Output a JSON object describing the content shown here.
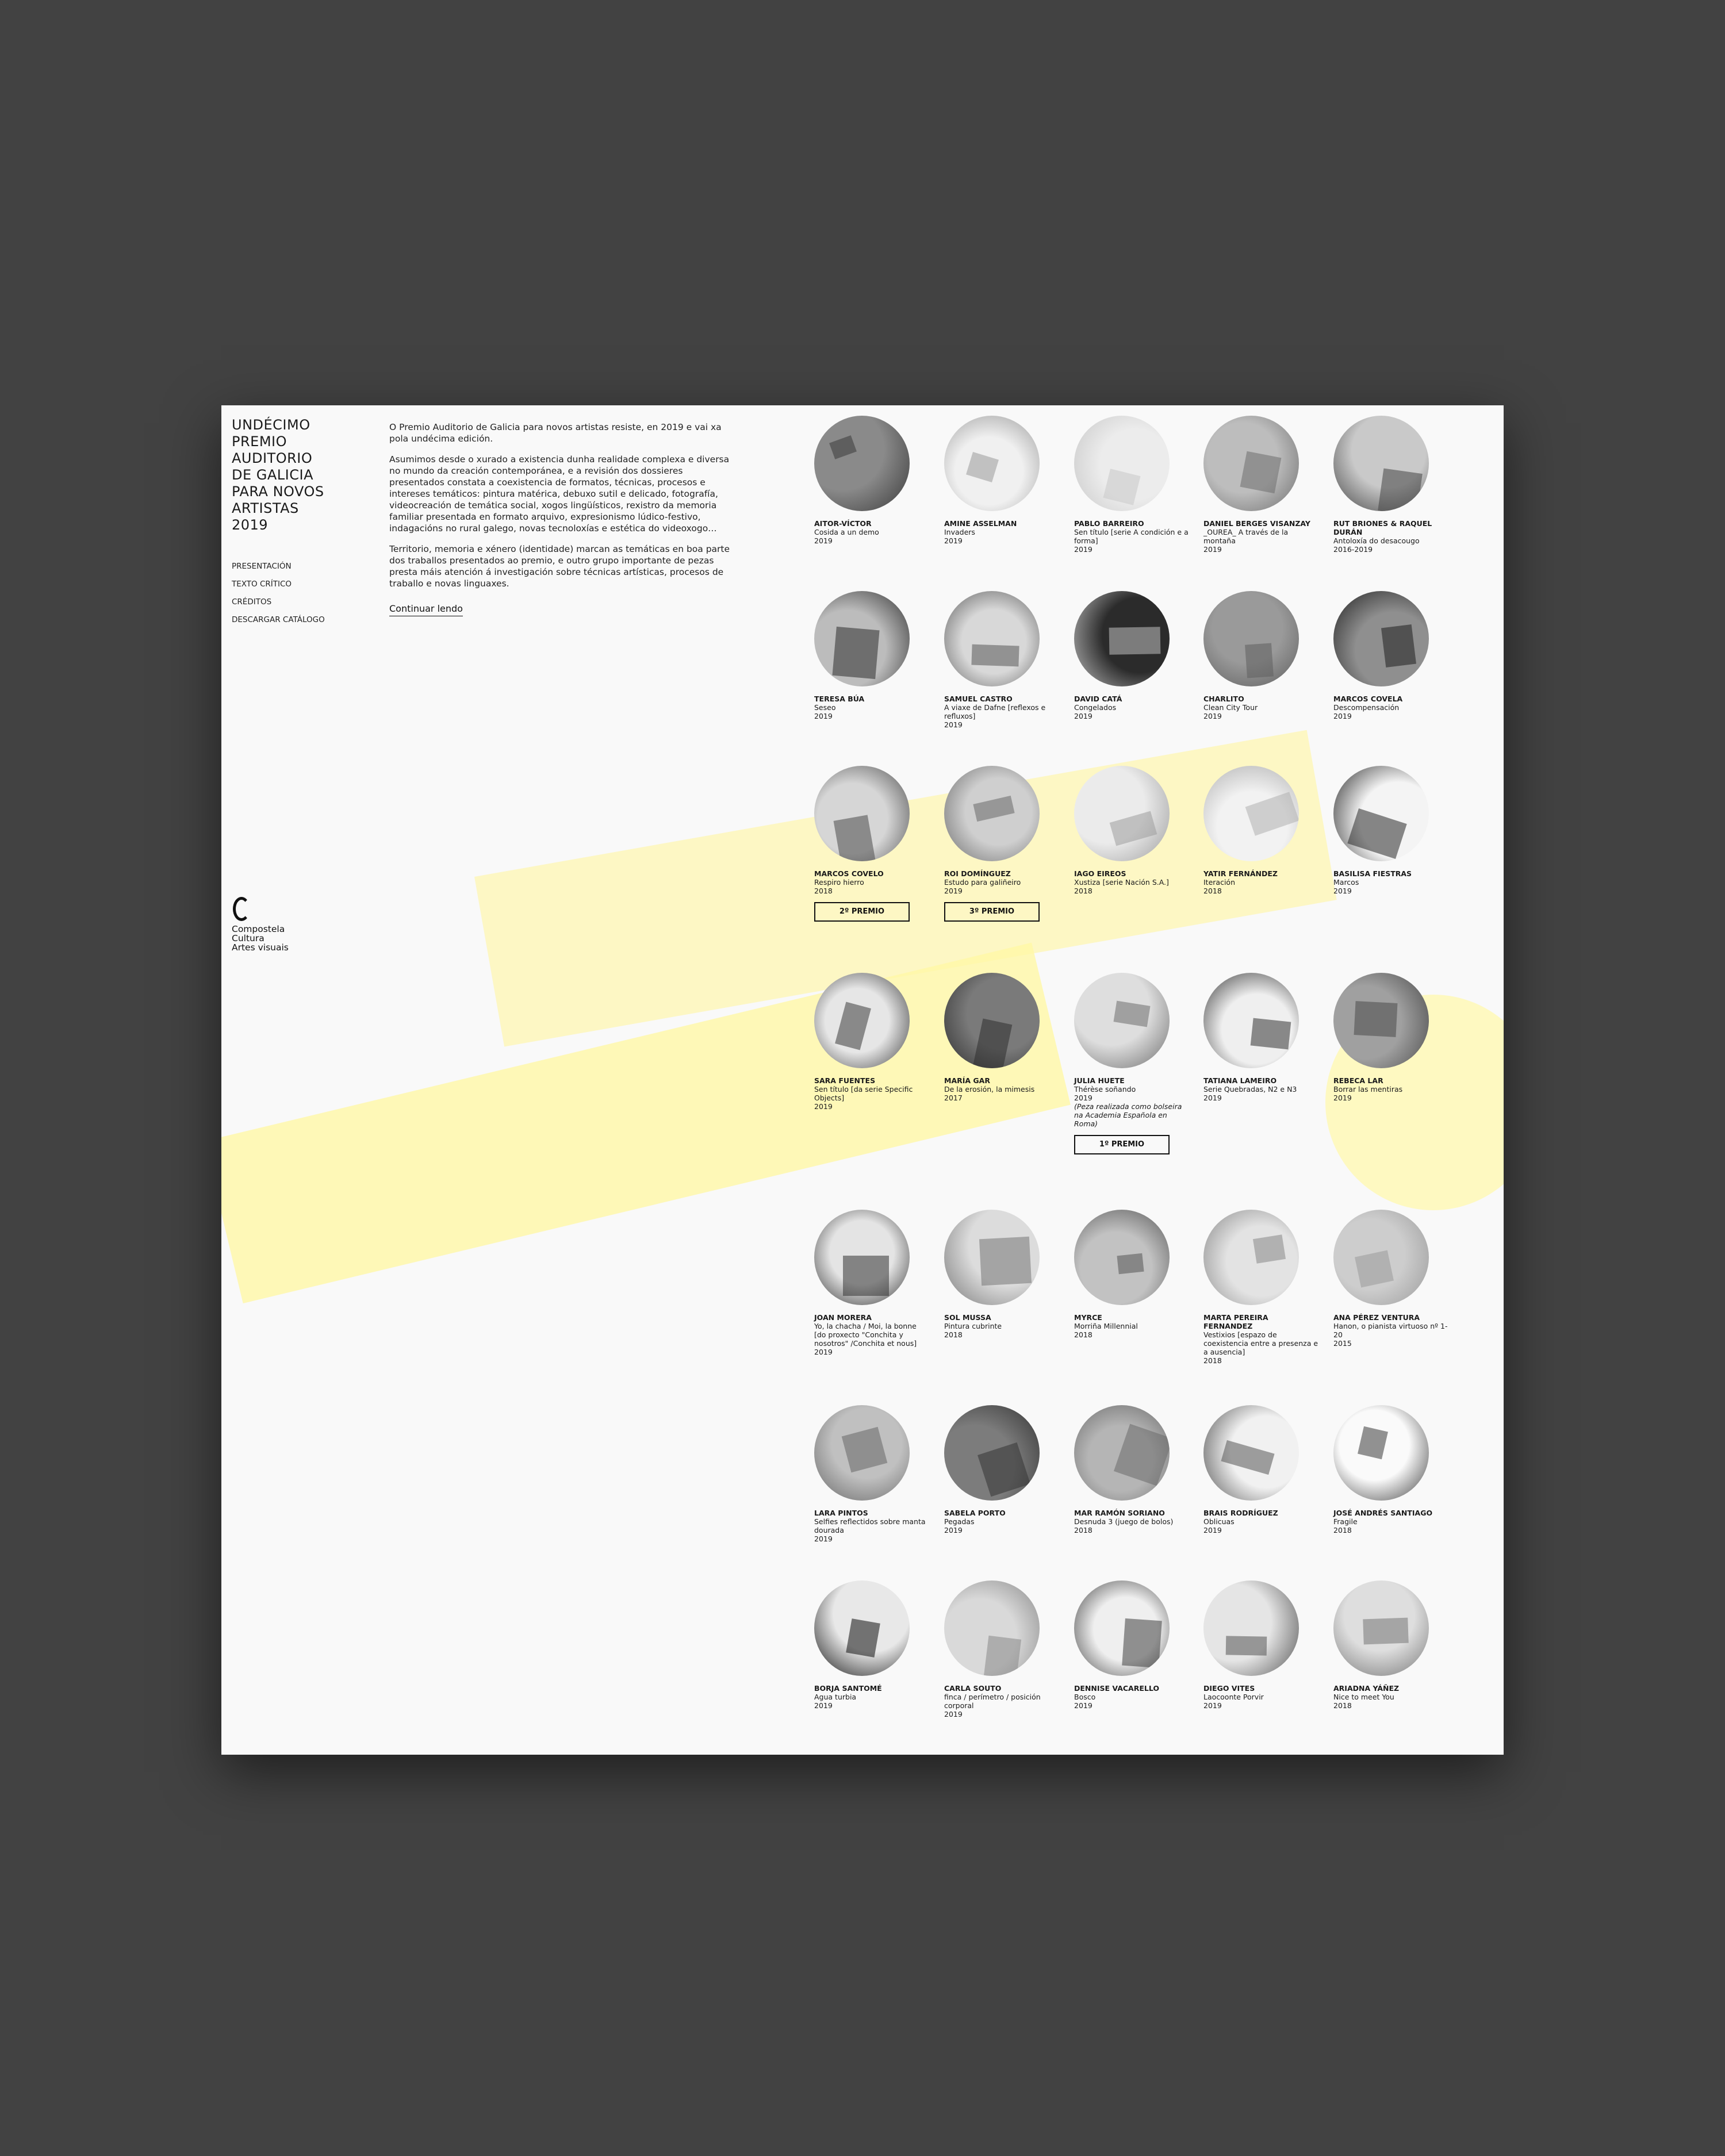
{
  "site": {
    "title": "UNDÉCIMO\nPREMIO\nAUDITORIO\nDE GALICIA\nPARA NOVOS\nARTISTAS\n2019"
  },
  "nav": {
    "items": [
      {
        "label": "PRESENTACIÓN"
      },
      {
        "label": "TEXTO CRÍTICO"
      },
      {
        "label": "CRÉDITOS"
      },
      {
        "label": "DESCARGAR CATÁLOGO"
      }
    ]
  },
  "intro": {
    "paragraphs": [
      "O Premio Auditorio de Galicia para novos artistas resiste, en 2019 e vai xa pola undécima edición.",
      "Asumimos desde o xurado a existencia dunha realidade complexa e diversa no mundo da creación contemporánea, e a revisión dos dossieres presentados constata a coexistencia de formatos, técnicas, procesos e intereses temáticos: pintura matérica, debuxo sutil e delicado, fotografía, videocreación de temática social, xogos lingüísticos, rexistro da memoria familiar presentada en formato arquivo, expresionismo lúdico-festivo, indagacións no rural galego, novas tecnoloxías e estética do videoxogo…",
      "Territorio, memoria e xénero (identidade) marcan as temáticas en boa parte dos traballos presentados ao premio, e outro grupo importante de pezas presta máis atención á investigación sobre técnicas artísticas, procesos de traballo e novas linguaxes."
    ],
    "continue_label": "Continuar lendo"
  },
  "logo": {
    "line1": "Compostela",
    "line2": "Cultura",
    "line3": "Artes visuais"
  },
  "colors": {
    "accent_yellow": "#fff59d",
    "page_bg": "#f9f9f9",
    "backdrop": "#424242"
  },
  "artists": [
    {
      "name": "AITOR-VÍCTOR",
      "work": "Cosida a un demo",
      "year": "2019"
    },
    {
      "name": "AMINE ASSELMAN",
      "work": "Invaders",
      "year": "2019"
    },
    {
      "name": "PABLO BARREIRO",
      "work": "Sen título [serie A condición e a forma]",
      "year": "2019"
    },
    {
      "name": "DANIEL BERGES VISANZAY",
      "work": "_OUREA_ A través de la montaña",
      "year": "2019"
    },
    {
      "name": "RUT BRIONES & RAQUEL DURÁN",
      "work": "Antoloxía do desacougo",
      "year": "2016-2019"
    },
    {
      "name": "TERESA BÚA",
      "work": "Seseo",
      "year": "2019"
    },
    {
      "name": "SAMUEL CASTRO",
      "work": "A viaxe de Dafne [reflexos e refluxos]",
      "year": "2019"
    },
    {
      "name": "DAVID CATÁ",
      "work": "Congelados",
      "year": "2019"
    },
    {
      "name": "CHARLITO",
      "work": "Clean City Tour",
      "year": "2019"
    },
    {
      "name": "MARCOS COVELA",
      "work": "Descompensación",
      "year": "2019"
    },
    {
      "name": "MARCOS COVELO",
      "work": "Respiro hierro",
      "year": "2018",
      "prize": "2º PREMIO"
    },
    {
      "name": "ROI DOMÍNGUEZ",
      "work": "Estudo para galiñeiro",
      "year": "2019",
      "prize": "3º PREMIO"
    },
    {
      "name": "IAGO EIREOS",
      "work": "Xustiza [serie Nación S.A.]",
      "year": "2018"
    },
    {
      "name": "YATIR FERNÁNDEZ",
      "work": "Iteración",
      "year": "2018"
    },
    {
      "name": "BASILISA FIESTRAS",
      "work": "Marcos",
      "year": "2019"
    },
    {
      "name": "SARA FUENTES",
      "work": "Sen título [da serie Specific Objects]",
      "year": "2019"
    },
    {
      "name": "MARÍA GAR",
      "work": "De la erosión, la mimesis",
      "year": "2017"
    },
    {
      "name": "JULIA HUETE",
      "work": "Thérèse soñando",
      "year": "2019",
      "note": "(Peza realizada como bolseira na Academia Española en Roma)",
      "prize": "1º PREMIO"
    },
    {
      "name": "TATIANA LAMEIRO",
      "work": "Serie Quebradas, N2 e N3",
      "year": "2019"
    },
    {
      "name": "REBECA LAR",
      "work": "Borrar las mentiras",
      "year": "2019"
    },
    {
      "name": "JOAN MORERA",
      "work": "Yo, la chacha / Moi, la bonne [do proxecto \"Conchita y nosotros\" /Conchita et nous]",
      "year": "2019"
    },
    {
      "name": "SOL MUSSA",
      "work": "Pintura cubrinte",
      "year": "2018"
    },
    {
      "name": "MYRCE",
      "work": "Morriña Millennial",
      "year": "2018"
    },
    {
      "name": "MARTA PEREIRA FERNANDEZ",
      "work": "Vestixios [espazo de coexistencia entre a presenza e a ausencia]",
      "year": "2018"
    },
    {
      "name": "ANA PÉREZ VENTURA",
      "work": "Hanon, o pianista virtuoso nº 1-20",
      "year": "2015"
    },
    {
      "name": "LARA PINTOS",
      "work": "Selfies reflectidos sobre manta dourada",
      "year": "2019"
    },
    {
      "name": "SABELA PORTO",
      "work": "Pegadas",
      "year": "2019"
    },
    {
      "name": "MAR RAMÓN SORIANO",
      "work": "Desnuda 3 (juego de bolos)",
      "year": "2018"
    },
    {
      "name": "BRAIS RODRÍGUEZ",
      "work": "Oblicuas",
      "year": "2019"
    },
    {
      "name": "JOSÉ ANDRÉS SANTIAGO",
      "work": "Fragile",
      "year": "2018"
    },
    {
      "name": "BORJA SANTOMÉ",
      "work": "Agua turbia",
      "year": "2019"
    },
    {
      "name": "CARLA SOUTO",
      "work": "finca / perímetro / posición corporal",
      "year": "2019"
    },
    {
      "name": "DENNISE VACARELLO",
      "work": "Bosco",
      "year": "2019"
    },
    {
      "name": "DIEGO VITES",
      "work": "Laocoonte Porvir",
      "year": "2019"
    },
    {
      "name": "ARIADNA YÁÑEZ",
      "work": "Nice to meet You",
      "year": "2018"
    }
  ]
}
